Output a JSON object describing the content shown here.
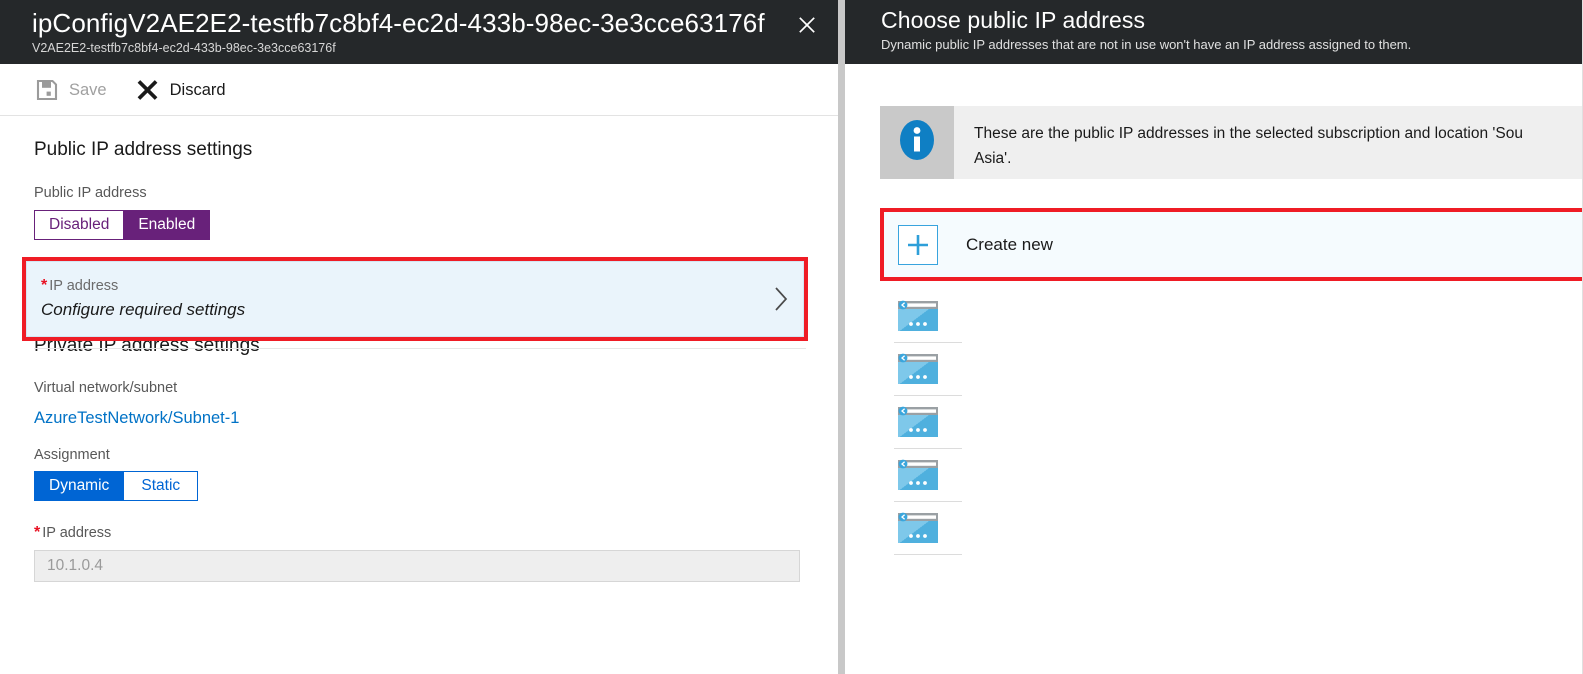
{
  "left_blade": {
    "header": {
      "title": "ipConfigV2AE2E2-testfb7c8bf4-ec2d-433b-98ec-3e3cce63176f",
      "subtitle": "V2AE2E2-testfb7c8bf4-ec2d-433b-98ec-3e3cce63176f",
      "close_icon": "close-icon"
    },
    "commandbar": {
      "save_label": "Save",
      "save_icon": "save-icon",
      "save_disabled": true,
      "discard_label": "Discard",
      "discard_icon": "discard-x-icon"
    },
    "public_section": {
      "title": "Public IP address settings",
      "toggle_label": "Public IP address",
      "toggle_options": [
        "Disabled",
        "Enabled"
      ],
      "toggle_selected": "Enabled",
      "selector": {
        "required_mark": "*",
        "label": "IP address",
        "value": "Configure required settings",
        "chevron_icon": "chevron-right-icon",
        "highlighted": true
      }
    },
    "private_section": {
      "title": "Private IP address settings",
      "vnet_label": "Virtual network/subnet",
      "vnet_value": "AzureTestNetwork/Subnet-1",
      "assignment_label": "Assignment",
      "assignment_options": [
        "Dynamic",
        "Static"
      ],
      "assignment_selected": "Dynamic",
      "ip_required_mark": "*",
      "ip_label": "IP address",
      "ip_value": "10.1.0.4",
      "ip_disabled": true
    }
  },
  "right_blade": {
    "header": {
      "title": "Choose public IP address",
      "subtitle": "Dynamic public IP addresses that are not in use won't have an IP address assigned to them."
    },
    "info_banner": {
      "icon": "info-icon",
      "line1": "These are the public IP addresses in the selected subscription and location 'Sou",
      "line2": "Asia'."
    },
    "create_new": {
      "label": "Create new",
      "icon": "plus-icon",
      "highlighted": true
    },
    "ip_list": [
      {
        "icon": "public-ip-address-icon",
        "name": ""
      },
      {
        "icon": "public-ip-address-icon",
        "name": ""
      },
      {
        "icon": "public-ip-address-icon",
        "name": ""
      },
      {
        "icon": "public-ip-address-icon",
        "name": ""
      },
      {
        "icon": "public-ip-address-icon",
        "name": ""
      }
    ]
  },
  "colors": {
    "header_bg": "#25282a",
    "purple": "#68217a",
    "blue": "#0065d4",
    "link_blue": "#0072c6",
    "highlight_red": "#ef1c25",
    "selector_bg": "#eaf4fb",
    "info_bg": "#efefef",
    "info_icon_blue": "#0f7fc4",
    "ip_icon_blue": "#59b4e3"
  }
}
